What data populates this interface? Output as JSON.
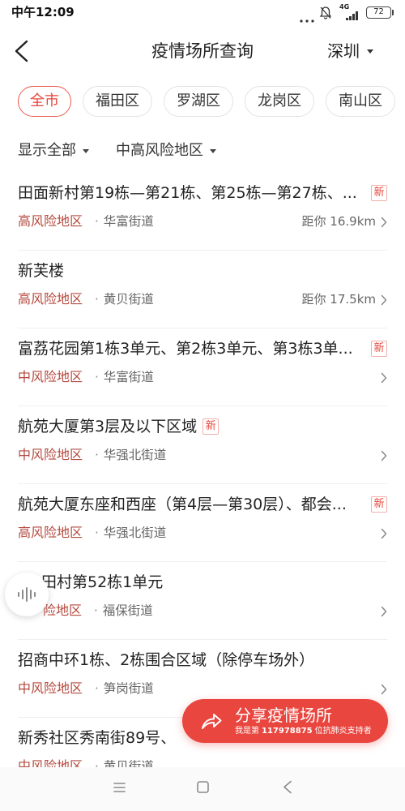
{
  "status_bar": {
    "time": "中午12:09",
    "network": "4G",
    "battery": "72"
  },
  "header": {
    "title": "疫情场所查询",
    "city": "深圳"
  },
  "districts": [
    {
      "label": "全市",
      "selected": true
    },
    {
      "label": "福田区",
      "selected": false
    },
    {
      "label": "罗湖区",
      "selected": false
    },
    {
      "label": "龙岗区",
      "selected": false
    },
    {
      "label": "南山区",
      "selected": false
    }
  ],
  "filters": {
    "display": "显示全部",
    "risk_level": "中高风险地区"
  },
  "list": {
    "separator": "·",
    "new_badge": "新"
  },
  "locations": [
    {
      "name": "田面新村第19栋—第21栋、第25栋—第27栋、...",
      "new": true,
      "risk": "高风险地区",
      "street": "华富街道",
      "distance": "距你 16.9km"
    },
    {
      "name": "新芙楼",
      "new": false,
      "risk": "高风险地区",
      "street": "黄贝街道",
      "distance": "距你 17.5km"
    },
    {
      "name": "富荔花园第1栋3单元、第2栋3单元、第3栋3单...",
      "new": true,
      "risk": "中风险地区",
      "street": "华富街道"
    },
    {
      "name": "航苑大厦第3层及以下区域",
      "new": true,
      "risk": "中风险地区",
      "street": "华强北街道"
    },
    {
      "name": "航苑大厦东座和西座（第4层—第30层）、都会...",
      "new": true,
      "risk": "高风险地区",
      "street": "华强北街道"
    },
    {
      "name": "田村第52栋1单元",
      "new": false,
      "risk": "险地区",
      "street": "福保街道"
    },
    {
      "name": "招商中环1栋、2栋围合区域（除停车场外）",
      "new": false,
      "risk": "中风险地区",
      "street": "笋岗街道"
    },
    {
      "name": "新秀社区秀南街89号、",
      "new": false,
      "risk": "中风险地区",
      "street": "黄贝街道"
    }
  ],
  "share_button": {
    "label": "分享疫情场所",
    "supporter_prefix": "我是第",
    "supporter_number": "117978875",
    "supporter_suffix": "位抗肺炎支持者"
  },
  "colors": {
    "accent": "#e9463f",
    "risk_text": "#b5483d",
    "text_primary": "#222222",
    "text_secondary": "#666666",
    "divider": "#efefef"
  },
  "icons": {
    "back": "chevron-left-icon",
    "city_dropdown": "caret-down-icon",
    "item_arrow": "chevron-right-icon",
    "voice": "sound-wave-icon",
    "share": "share-arrow-icon",
    "status": [
      "more-dots-icon",
      "bell-off-icon",
      "signal-icon",
      "battery-icon"
    ],
    "system_nav": [
      "menu-icon",
      "home-square-icon",
      "back-triangle-icon"
    ]
  }
}
